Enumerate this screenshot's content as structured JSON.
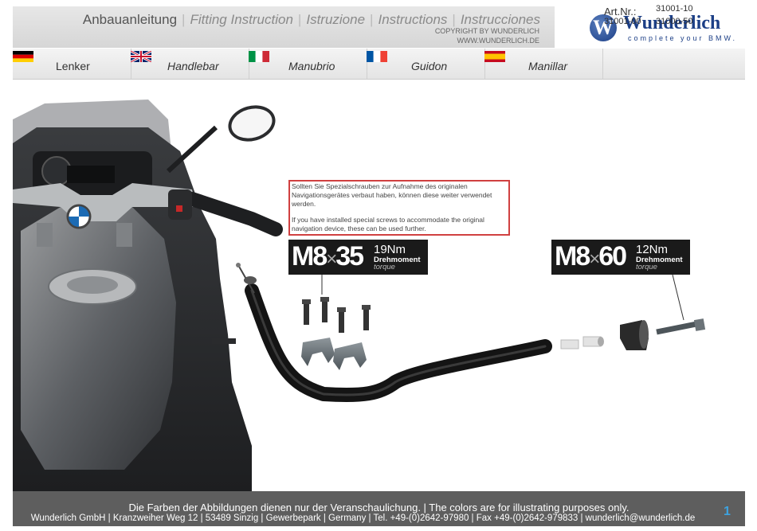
{
  "header": {
    "title_de": "Anbauanleitung",
    "title_en": "Fitting Instruction",
    "title_it": "Istruzione",
    "title_fr": "Instructions",
    "title_es": "Instrucciones",
    "copyright": "COPYRIGHT BY WUNDERLICH",
    "website": "WWW.WUNDERLICH.DE",
    "logo_name": "Wunderlich",
    "logo_tagline": "complete your BMW."
  },
  "languages": [
    {
      "label": "Lenker",
      "flag": "germany-flag"
    },
    {
      "label": "Handlebar",
      "flag": "uk-flag"
    },
    {
      "label": "Manubrio",
      "flag": "italy-flag"
    },
    {
      "label": "Guidon",
      "flag": "france-flag"
    },
    {
      "label": "Manillar",
      "flag": "spain-flag"
    }
  ],
  "article": {
    "label": "Art.Nr.:",
    "numbers": [
      "31001-10",
      "31001-00",
      "31000-50"
    ]
  },
  "notice": {
    "de": "Sollten Sie Spezialschrauben zur Aufnahme des originalen Navigationsgerätes verbaut haben, können diese weiter verwendet werden.",
    "en": "If you have installed special screws to accommodate the original navigation device, these can be used further."
  },
  "torque_labels": [
    {
      "thread": "M8",
      "length": "35",
      "value": "19Nm",
      "de": "Drehmoment",
      "en": "torque"
    },
    {
      "thread": "M8",
      "length": "60",
      "value": "12Nm",
      "de": "Drehmoment",
      "en": "torque"
    }
  ],
  "footer": {
    "line1": "Die Farben der Abbildungen dienen nur der Veranschaulichung.  | The colors are for illustrating purposes only.",
    "line2": "Wunderlich GmbH | Kranzweiher Weg 12 | 53489 Sinzig | Gewerbepark | Germany | Tel. +49-(0)2642-97980 | Fax +49-(0)2642-979833 | wunderlich@wunderlich.de",
    "page": "1"
  },
  "colors": {
    "brand_blue": "#1c3f86",
    "notice_border": "#d04040",
    "page_number": "#3da3e0"
  }
}
